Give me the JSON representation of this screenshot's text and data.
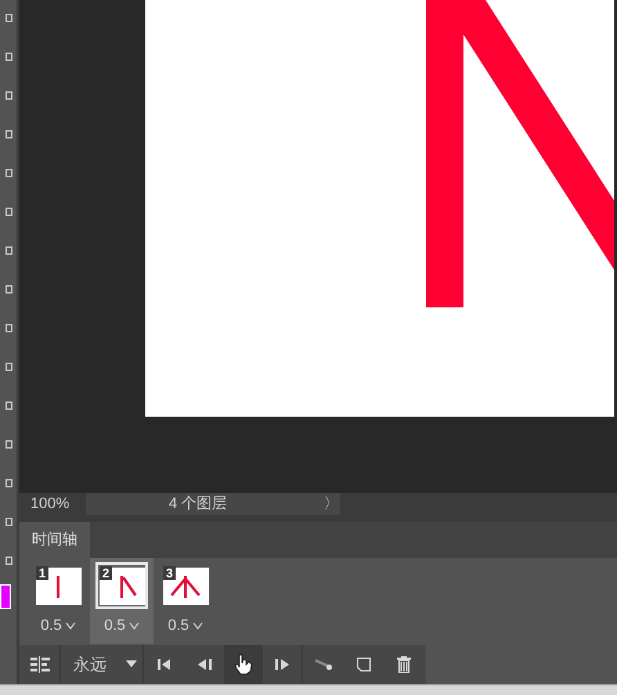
{
  "status_bar": {
    "zoom": "100%",
    "info": "4 个图层",
    "arrow": "〉"
  },
  "panel": {
    "tab": "时间轴"
  },
  "frames": [
    {
      "number": "1",
      "delay": "0.5",
      "selected": false,
      "kind": "bar"
    },
    {
      "number": "2",
      "delay": "0.5",
      "selected": true,
      "kind": "slash"
    },
    {
      "number": "3",
      "delay": "0.5",
      "selected": false,
      "kind": "roof"
    }
  ],
  "controls": {
    "loop": "永远"
  },
  "swatch": {
    "color": "#e600ff"
  }
}
